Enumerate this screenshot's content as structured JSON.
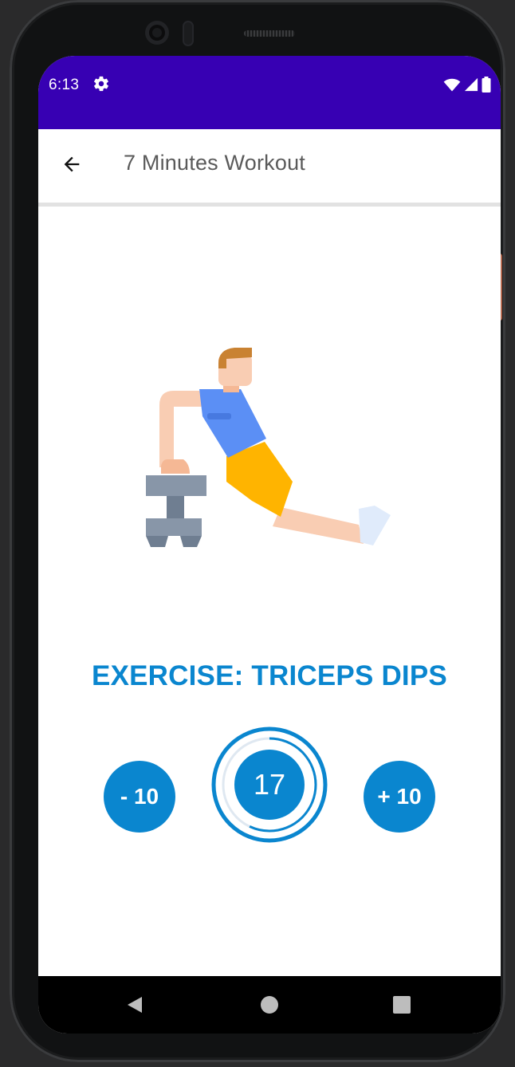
{
  "status_bar": {
    "time": "6:13",
    "settings_icon": "gear-icon",
    "icons": [
      "wifi-icon",
      "signal-icon",
      "battery-icon"
    ],
    "background_color": "#3700b3"
  },
  "app_bar": {
    "back_icon": "arrow-left-icon",
    "title": "7 Minutes Workout"
  },
  "exercise": {
    "illustration": "triceps-dips-illustration",
    "title": "EXERCISE: TRICEPS DIPS"
  },
  "controls": {
    "minus_label": "- 10",
    "plus_label": "+ 10",
    "timer_value": "17",
    "timer_progress": 0.57,
    "accent_color": "#0a86cf"
  },
  "nav_bar": {
    "icons": [
      "nav-back-icon",
      "nav-home-icon",
      "nav-recents-icon"
    ]
  }
}
